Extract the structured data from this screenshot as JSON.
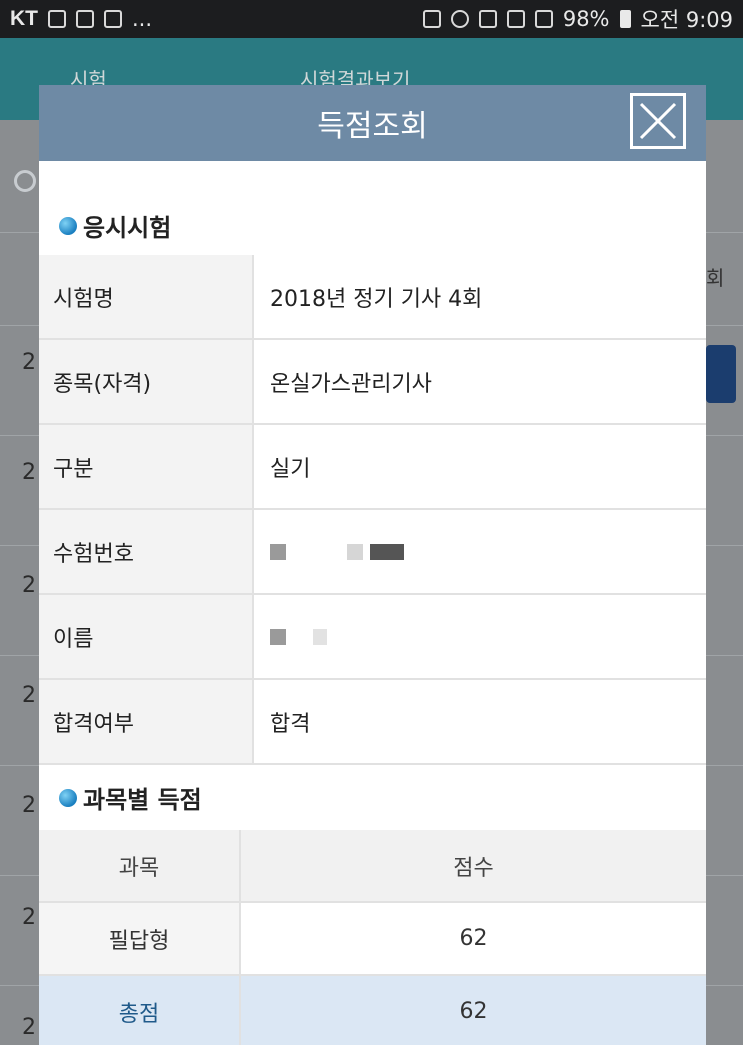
{
  "status_bar": {
    "carrier": "KT",
    "more": "...",
    "battery": "98%",
    "time": "오전 9:09"
  },
  "background": {
    "header_left": "시험",
    "header_right": "시험결과보기",
    "row_digit": "2",
    "edge_text": "회"
  },
  "modal": {
    "title": "득점조회",
    "sections": {
      "exam": {
        "heading": "응시시험",
        "rows": [
          {
            "label": "시험명",
            "value": "2018년 정기 기사 4회"
          },
          {
            "label": "종목(자격)",
            "value": "온실가스관리기사"
          },
          {
            "label": "구분",
            "value": "실기"
          },
          {
            "label": "수험번호",
            "value": ""
          },
          {
            "label": "이름",
            "value": ""
          },
          {
            "label": "합격여부",
            "value": "합격"
          }
        ]
      },
      "scores": {
        "heading": "과목별 득점",
        "columns": [
          "과목",
          "점수"
        ],
        "rows": [
          {
            "subject": "필답형",
            "score": "62"
          }
        ],
        "total": {
          "label": "총점",
          "score": "62"
        }
      }
    }
  },
  "colors": {
    "header_bg": "#6e8aa5",
    "bullet": "#1a7fc0",
    "total_row_bg": "#dbe7f4"
  }
}
